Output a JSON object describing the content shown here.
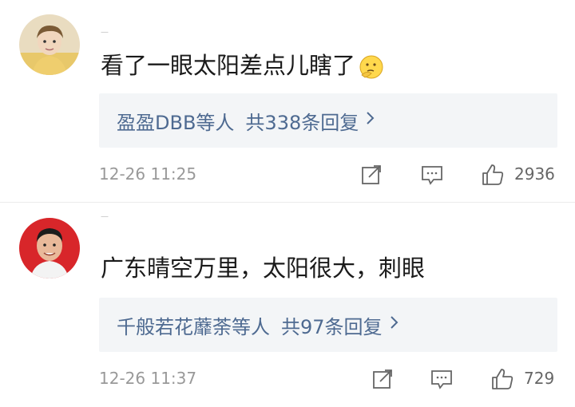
{
  "comments": [
    {
      "text": "看了一眼太阳差点儿瞎了",
      "emoji": "thinking-face-emoji",
      "reply_names": "盈盈DBB等人",
      "reply_count": "共338条回复",
      "timestamp": "12-26 11:25",
      "likes": "2936"
    },
    {
      "text": "广东晴空万里，太阳很大，刺眼",
      "reply_names": "千般若花蘼荼等人",
      "reply_count": "共97条回复",
      "timestamp": "12-26 11:37",
      "likes": "729"
    }
  ],
  "icons": {
    "share": "share-icon",
    "comment": "comment-icon",
    "like": "thumbs-up-icon",
    "chevron": "chevron-right-icon"
  },
  "colors": {
    "link": "#4e6a91",
    "reply_bg": "#f3f5f7",
    "meta": "#999999"
  }
}
